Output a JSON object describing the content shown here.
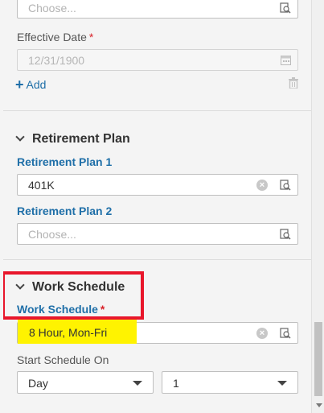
{
  "top_field": {
    "placeholder": "Choose..."
  },
  "effective_date": {
    "label": "Effective Date",
    "required": "*",
    "value": "12/31/1900"
  },
  "add_link": {
    "label": "Add"
  },
  "retirement": {
    "header": "Retirement Plan",
    "plan1": {
      "label": "Retirement Plan 1",
      "value": "401K",
      "clear": "×"
    },
    "plan2": {
      "label": "Retirement Plan 2",
      "placeholder": "Choose..."
    }
  },
  "work_schedule": {
    "header": "Work Schedule",
    "field_label": "Work Schedule",
    "required": "*",
    "value": "8 Hour, Mon-Fri",
    "clear": "×",
    "start_label": "Start Schedule On",
    "unit_select": "Day",
    "number_select": "1"
  },
  "colors": {
    "accent": "#1f6fa8",
    "required": "#d9242b",
    "highlight_border": "#e8162b",
    "highlight_fill": "#fff300"
  },
  "icons": [
    "lookup-icon",
    "calendar-icon",
    "plus-icon",
    "trash-icon",
    "chevron-down-icon",
    "clear-icon",
    "caret-down-icon"
  ]
}
